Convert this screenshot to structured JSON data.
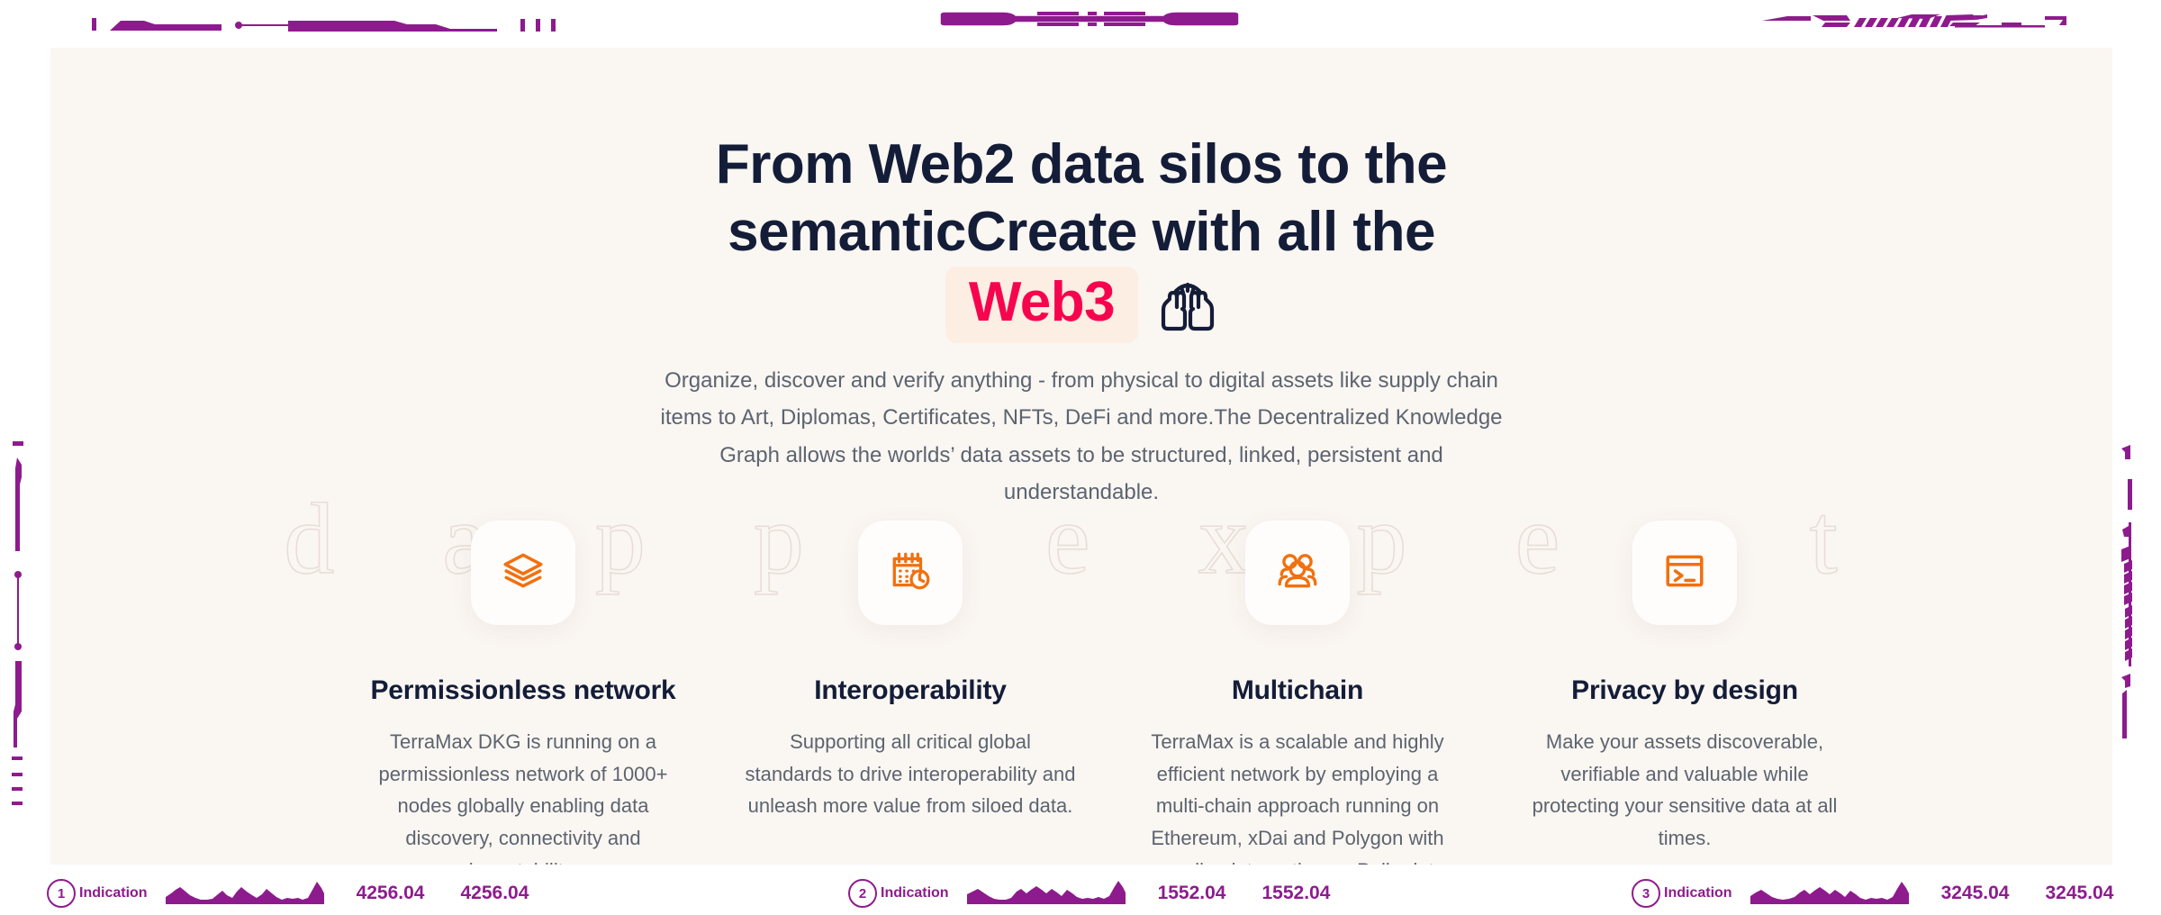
{
  "hero": {
    "headline_line1": "From Web2 data silos to the",
    "headline_line2": "semanticCreate with all the",
    "headline_badge": "Web3",
    "headline_icon": "raised-hands-icon",
    "lead": "Organize, discover and verify anything - from physical to digital assets like supply chain items to Art, Diplomas, Certificates, NFTs, DeFi and more.The Decentralized Knowledge Graph allows the worlds’ data assets to be structured, linked, persistent and understandable."
  },
  "watermark": "d a p p . e x p e r t",
  "features": [
    {
      "icon": "layers-icon",
      "title": "Permissionless network",
      "desc": "TerraMax DKG is running on a permissionless network of 1000+ nodes globally enabling data discovery, connectivity and immutability."
    },
    {
      "icon": "calendar-clock-icon",
      "title": "Interoperability",
      "desc": "Supporting all critical global standards to drive interoperability and unleash more value from siloed data."
    },
    {
      "icon": "users-group-icon",
      "title": "Multichain",
      "desc": "TerraMax is a scalable and highly efficient network by employing a multi-chain approach running on Ethereum, xDai and Polygon with pending integration on Polkadot."
    },
    {
      "icon": "terminal-icon",
      "title": "Privacy by design",
      "desc": "Make your assets discoverable, verifiable and valuable while protecting your sensitive data at all times."
    }
  ],
  "statusbar": {
    "items": [
      {
        "number": "1",
        "label": "Indication",
        "value_a": "4256.04",
        "value_b": "4256.04"
      },
      {
        "number": "2",
        "label": "Indication",
        "value_a": "1552.04",
        "value_b": "1552.04"
      },
      {
        "number": "3",
        "label": "Indication",
        "value_a": "3245.04",
        "value_b": "3245.04"
      }
    ]
  },
  "colors": {
    "panel_bg": "#faf6f2",
    "heading": "#141d38",
    "body_text": "#5c6470",
    "accent_orange": "#f2700f",
    "accent_pink": "#f6054e",
    "badge_bg": "#fdeee4",
    "hud_purple": "#8e1b8e"
  }
}
